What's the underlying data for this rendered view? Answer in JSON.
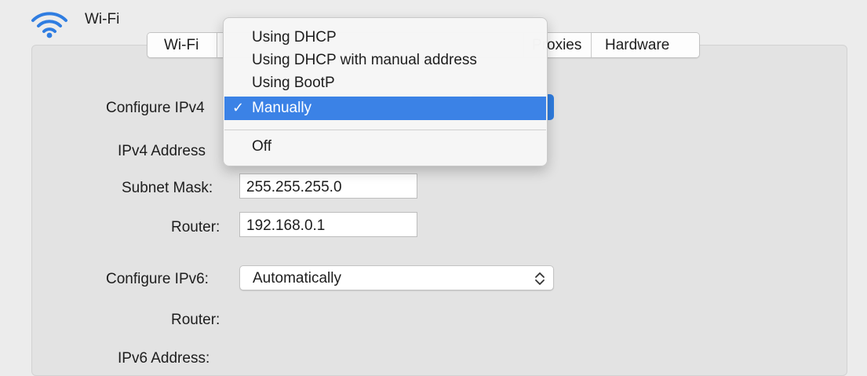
{
  "header": {
    "title": "Wi-Fi",
    "icon": "wifi-icon"
  },
  "tabs": [
    {
      "label": "Wi-Fi"
    },
    {
      "label": ""
    },
    {
      "label": "Proxies"
    },
    {
      "label": "Hardware"
    }
  ],
  "form": {
    "configure_ipv4_label": "Configure IPv4",
    "ipv4_address_label": "IPv4 Address",
    "subnet_mask_label": "Subnet Mask:",
    "subnet_mask_value": "255.255.255.0",
    "router_label": "Router:",
    "router_value": "192.168.0.1",
    "configure_ipv6_label": "Configure IPv6:",
    "configure_ipv6_value": "Automatically",
    "ipv6_router_label": "Router:",
    "ipv6_address_label": "IPv6 Address:"
  },
  "menu": {
    "items": [
      {
        "label": "Using DHCP",
        "selected": false
      },
      {
        "label": "Using DHCP with manual address",
        "selected": false
      },
      {
        "label": "Using BootP",
        "selected": false
      },
      {
        "label": "Manually",
        "selected": true
      },
      {
        "label": "Off",
        "selected": false
      }
    ],
    "check_glyph": "✓"
  },
  "colors": {
    "accent": "#3b82e6",
    "wifi_icon": "#2f7de1",
    "window_bg": "#ececec",
    "panel_bg": "#e3e3e3"
  }
}
